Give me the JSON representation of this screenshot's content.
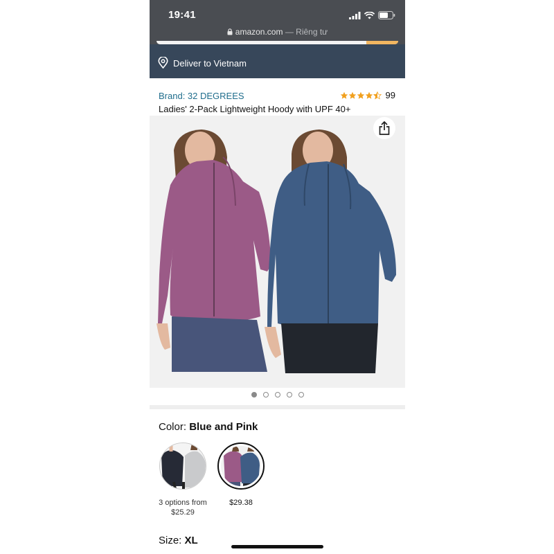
{
  "status_bar": {
    "time": "19:41"
  },
  "browser": {
    "domain": "amazon.com",
    "separator": " — ",
    "privacy_label": "Riêng tư"
  },
  "delivery": {
    "text": "Deliver to Vietnam"
  },
  "product": {
    "brand": "Brand: 32 DEGREES",
    "rating": 4.5,
    "rating_count": "99",
    "title": "Ladies' 2-Pack Lightweight Hoody with UPF 40+"
  },
  "gallery": {
    "image_count": 5,
    "active_index": 0
  },
  "color": {
    "label": "Color:",
    "selected": "Blue and Pink",
    "options": [
      {
        "caption_line1": "3 options from",
        "caption_line2": "$25.29"
      },
      {
        "caption_line1": "$29.38",
        "caption_line2": ""
      }
    ]
  },
  "size": {
    "label": "Size:",
    "selected": "XL"
  },
  "colors": {
    "status_bar_bg": "#4a4d52",
    "delivery_bar_bg": "#37475a",
    "brand_link": "#1f6d8c",
    "star": "#f1a01e",
    "pink_hoodie": "#9b5a87",
    "blue_hoodie": "#3f5d85"
  }
}
